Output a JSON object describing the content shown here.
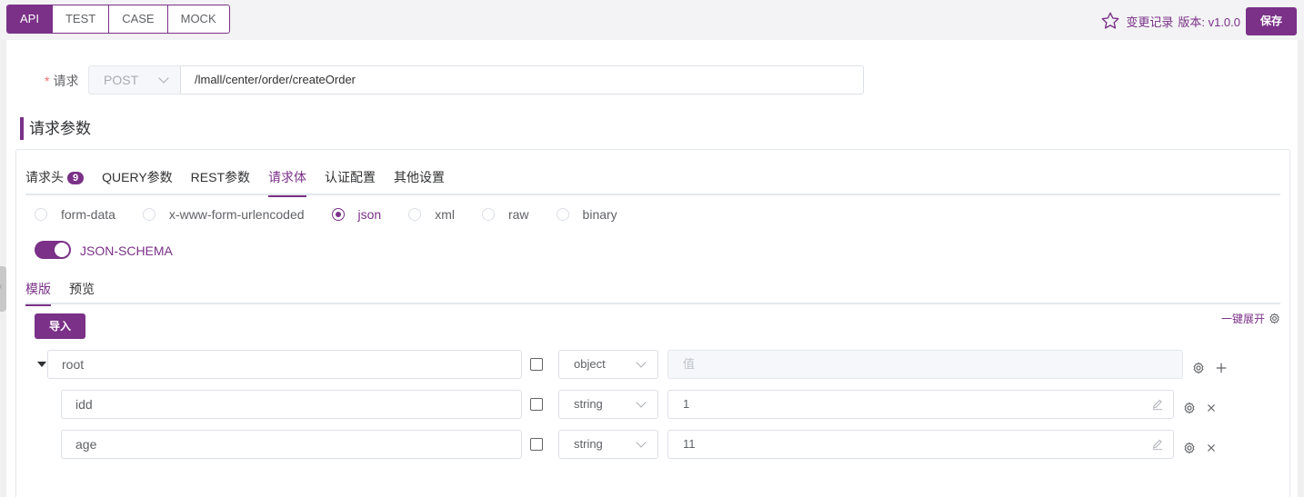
{
  "top_tabs": [
    "API",
    "TEST",
    "CASE",
    "MOCK"
  ],
  "changelog_label": "变更记录",
  "version_label": "版本: v1.0.0",
  "save_label": "保存",
  "request": {
    "label": "请求",
    "required_mark": "*",
    "method": "POST",
    "url": "/lmall/center/order/createOrder"
  },
  "section_title": "请求参数",
  "param_tabs": [
    {
      "label": "请求头",
      "badge": "9"
    },
    {
      "label": "QUERY参数"
    },
    {
      "label": "REST参数"
    },
    {
      "label": "请求体",
      "active": true
    },
    {
      "label": "认证配置"
    },
    {
      "label": "其他设置"
    }
  ],
  "body_types": [
    "form-data",
    "x-www-form-urlencoded",
    "json",
    "xml",
    "raw",
    "binary"
  ],
  "body_type_selected": "json",
  "schema_toggle_label": "JSON-SCHEMA",
  "schema_toggle_on": true,
  "schema_tabs": [
    "模版",
    "预览"
  ],
  "import_label": "导入",
  "expand_label": "一键展开",
  "schema_rows": [
    {
      "name": "root",
      "type": "object",
      "value_placeholder": "值",
      "value": "",
      "is_root": true
    },
    {
      "name": "idd",
      "type": "string",
      "value": "1"
    },
    {
      "name": "age",
      "type": "string",
      "value": "11"
    }
  ],
  "accent_color": "#7a3187"
}
